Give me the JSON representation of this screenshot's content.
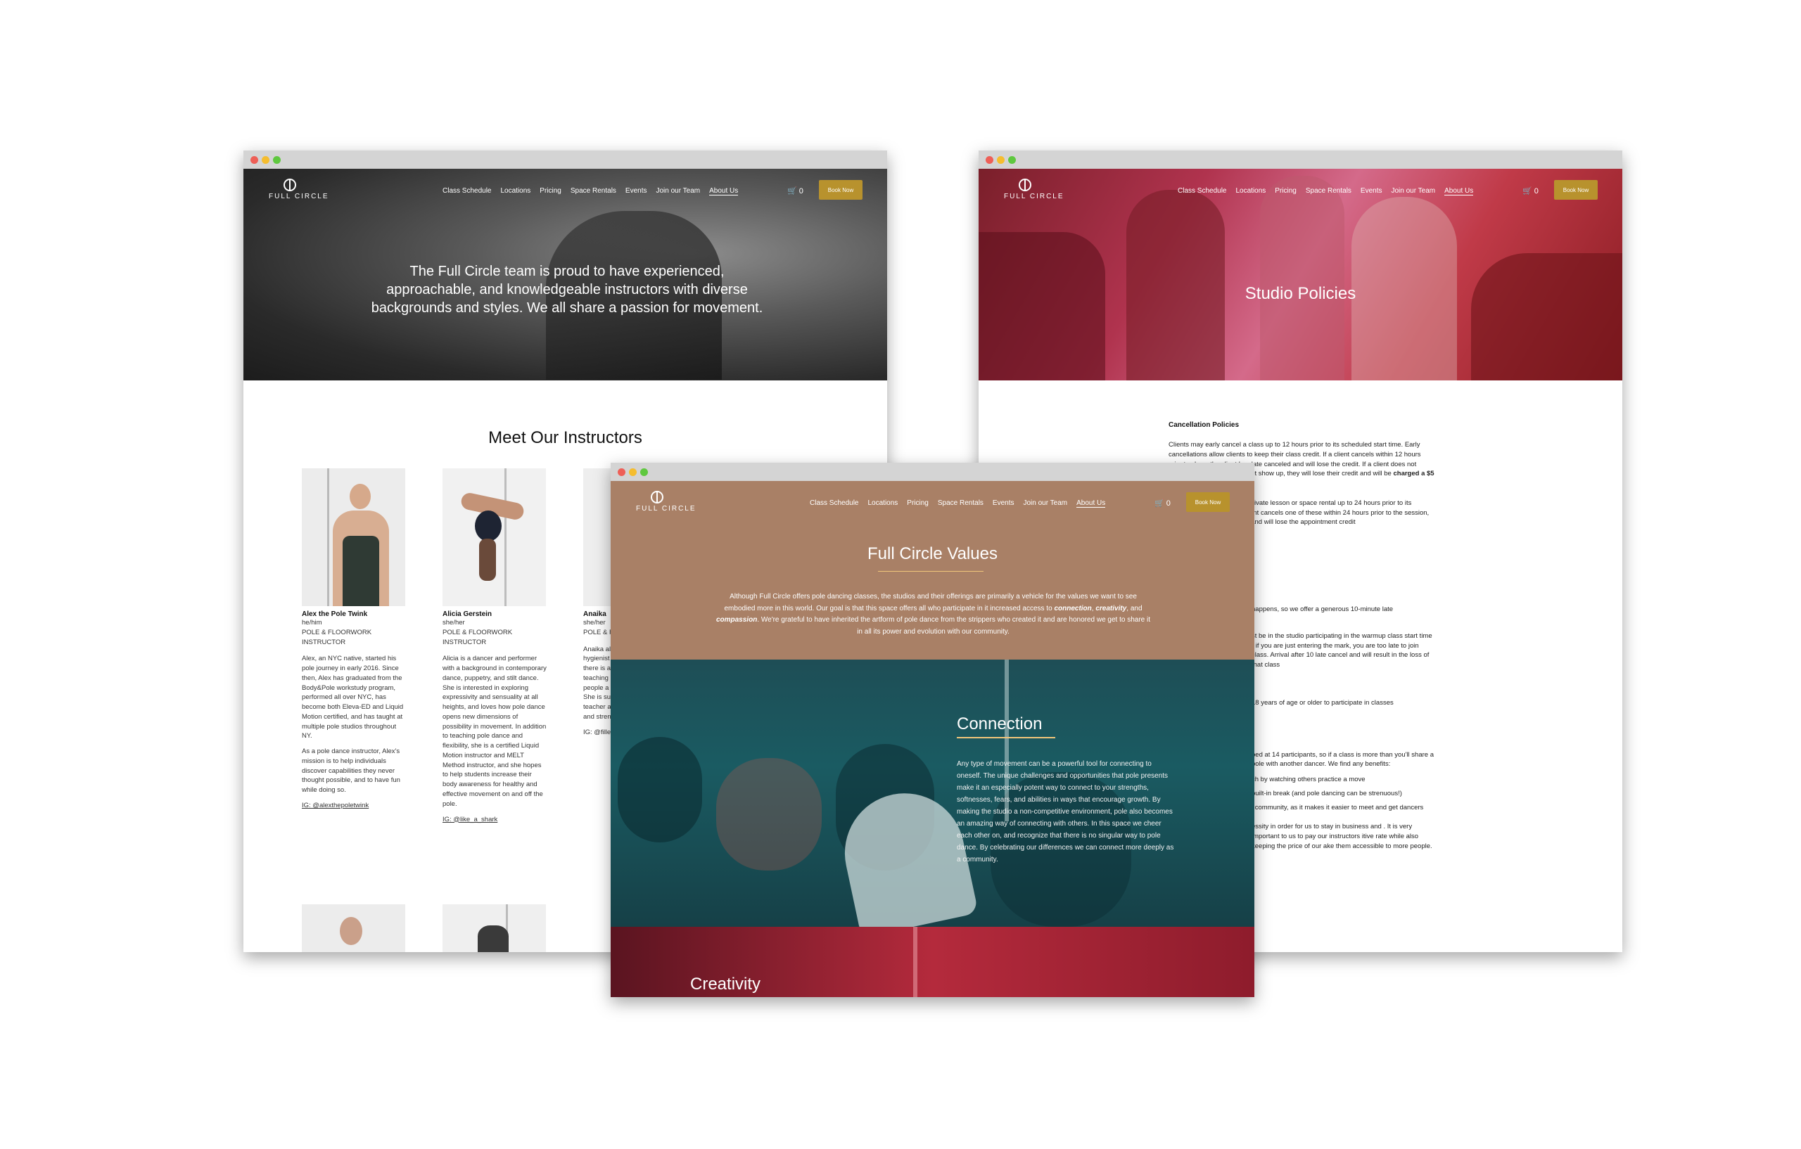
{
  "nav": {
    "logo": "FULL CIRCLE",
    "links": [
      "Class Schedule",
      "Locations",
      "Pricing",
      "Space Rentals",
      "Events",
      "Join our Team",
      "About Us"
    ],
    "cart": "0",
    "book": "Book Now"
  },
  "win_left": {
    "hero_text": "The Full Circle team is proud to have experienced, approachable, and knowledgeable instructors with diverse backgrounds and styles. We all share a passion for movement.",
    "heading": "Meet Our Instructors",
    "instructors": [
      {
        "name": "Alex the Pole Twink",
        "pronouns": "he/him",
        "role1": "POLE & FLOORWORK",
        "role2": "INSTRUCTOR",
        "bio1": "Alex, an NYC native, started his pole journey in early 2016. Since then, Alex has graduated from the Body&Pole workstudy program, performed all over NYC, has become both Eleva-ED and Liquid Motion certified, and has taught at multiple pole studios throughout NY.",
        "bio2": "As a pole dance instructor, Alex's mission is to help individuals discover capabilities they never thought possible, and to have fun while doing so.",
        "ig": "IG: @alexthepoletwink"
      },
      {
        "name": "Alicia Gerstein",
        "pronouns": "she/her",
        "role1": "POLE & FLOORWORK",
        "role2": "INSTRUCTOR",
        "bio1": "Alicia is a dancer and performer with a background in contemporary dance, puppetry, and stilt dance. She is interested in exploring expressivity and sensuality at all heights, and loves how pole dance opens new dimensions of possibility in movement. In addition to teaching pole dance and flexibility, she is a certified Liquid Motion instructor and MELT Method instructor, and she hopes to help students increase their body awareness for healthy and effective movement on and off the pole.",
        "bio2": "",
        "ig": "IG: @like_a_shark"
      },
      {
        "name": "Anaika",
        "pronouns": "she/her",
        "role1": "POLE & F",
        "role2": "",
        "bio1": "Anaika al hygienist there is a teaching people a She is su teacher a and stren",
        "bio2": "",
        "ig": "IG: @fille"
      }
    ]
  },
  "win_right": {
    "hero_title": "Studio Policies",
    "section_title": "Cancellation Policies",
    "p1": "Clients may early cancel a class up to 12 hours prior to its scheduled start time. Early cancellations allow clients to keep their class credit. If a client cancels within 12 hours prior to class, the client has late canceled and will lose the credit. If a client does not cancel the class and does not show up, they will lose their credit and will be",
    "p1_bold": "charged a $5 no-show",
    "p2": "Clients may early cancel a private lesson or space rental up to 24 hours prior to its scheduled start time. If a client cancels one of these within 24 hours prior to the session, the client has late canceled and will lose the appointment credit",
    "p3": "happens, so we offer a generous 10-minute late",
    "p4": "st be in the studio participating in the warmup class start time - if you are just entering the mark, you are too late to join class. Arrival after 10 late cancel and will result in the loss of that class",
    "p5": "18 years of age or older to participate in classes",
    "p6": "ped at 14 participants, so if a class is more than you'll share a pole with another dancer. We find any benefits:",
    "bullets": [
      "ch by watching others practice a move",
      "built-in break (and pole dancing can be strenuous!)",
      "l community, as it makes it easier to meet and get dancers"
    ],
    "p7": "essity in order for us to stay in business and . It is very important to us to pay our instructors itive rate while also keeping the price of our ake them accessible to more people."
  },
  "win_front": {
    "title": "Full Circle Values",
    "intro_a": "Although Full Circle offers pole dancing classes, the studios and their offerings are primarily a vehicle for the values we want to see embodied more in this world. Our goal is that this space offers all who participate in it increased access to",
    "intro_b1": "connection",
    "intro_b2": "creativity",
    "intro_and": "and",
    "intro_b3": "compassion",
    "intro_c": "We're grateful to have inherited the artform of pole dance from the strippers who created it and are honored we get to share it in all its power and evolution with our community.",
    "connection_title": "Connection",
    "connection_text": "Any type of movement can be a powerful tool for connecting to oneself. The unique challenges and opportunities that pole presents make it an especially potent way to connect to your strengths, softnesses, fears, and abilities in ways that encourage growth. By making the studio a non-competitive environment, pole also becomes an amazing way of connecting with others. In this space we cheer each other on, and recognize that there is no singular way to pole dance. By celebrating our differences we can connect more deeply as a community.",
    "creativity_title": "Creativity"
  }
}
